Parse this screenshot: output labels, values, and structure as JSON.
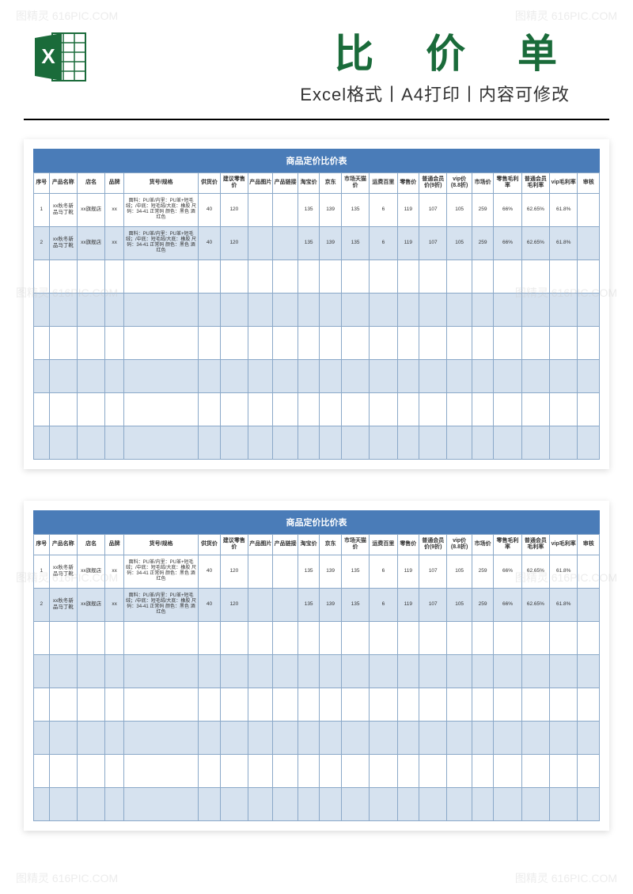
{
  "header": {
    "title": "比 价 单",
    "subtitle": "Excel格式丨A4打印丨内容可修改"
  },
  "watermarks": [
    "图精灵 616PIC.COM"
  ],
  "sheet": {
    "title": "商品定价比价表",
    "columns": [
      "序号",
      "产品名称",
      "店名",
      "品牌",
      "货号/规格",
      "供货价",
      "建议零售价",
      "产品图片",
      "产品链接",
      "淘宝价",
      "京东",
      "市场天猫价",
      "运费百里",
      "零售价",
      "普通会员价(9折)",
      "vip价(8.8折)",
      "市场价",
      "零售毛利率",
      "普通会员毛利率",
      "vip毛利率",
      "审核"
    ],
    "rows": [
      {
        "seq": "1",
        "name": "xx秋冬新品马丁靴",
        "shop": "xx旗舰店",
        "brand": "xx",
        "spec": "面料：PU革/内里：PU革+短毛绒；/中底：短毛绒/大底：橡胶 尺码：34-41 正常码 颜色：黑色 酒红色",
        "supply": "40",
        "suggest": "120",
        "img": "",
        "link": "",
        "taobao": "135",
        "jd": "139",
        "tmall": "135",
        "ship": "6",
        "retail": "119",
        "member": "107",
        "vip": "105",
        "market": "259",
        "retailrate": "66%",
        "memberrate": "62.65%",
        "viprate": "61.8%",
        "audit": ""
      },
      {
        "seq": "2",
        "name": "xx秋冬新品马丁靴",
        "shop": "xx旗舰店",
        "brand": "xx",
        "spec": "面料：PU革/内里：PU革+短毛绒；/中底：短毛绒/大底：橡胶 尺码：34-41 正常码 颜色：黑色 酒红色",
        "supply": "40",
        "suggest": "120",
        "img": "",
        "link": "",
        "taobao": "135",
        "jd": "139",
        "tmall": "135",
        "ship": "6",
        "retail": "119",
        "member": "107",
        "vip": "105",
        "market": "259",
        "retailrate": "66%",
        "memberrate": "62.65%",
        "viprate": "61.8%",
        "audit": ""
      }
    ],
    "empty_rows": 6
  },
  "chart_data": {
    "type": "table",
    "title": "商品定价比价表",
    "columns": [
      "序号",
      "产品名称",
      "店名",
      "品牌",
      "货号/规格",
      "供货价",
      "建议零售价",
      "淘宝价",
      "京东",
      "市场天猫价",
      "运费百里",
      "零售价",
      "普通会员价(9折)",
      "vip价(8.8折)",
      "市场价",
      "零售毛利率",
      "普通会员毛利率",
      "vip毛利率"
    ],
    "rows": [
      [
        1,
        "xx秋冬新品马丁靴",
        "xx旗舰店",
        "xx",
        "面料：PU革/内里：PU革+短毛绒；/中底：短毛绒/大底：橡胶 尺码：34-41 正常码 颜色：黑色 酒红色",
        40,
        120,
        135,
        139,
        135,
        6,
        119,
        107,
        105,
        259,
        "66%",
        "62.65%",
        "61.8%"
      ],
      [
        2,
        "xx秋冬新品马丁靴",
        "xx旗舰店",
        "xx",
        "面料：PU革/内里：PU革+短毛绒；/中底：短毛绒/大底：橡胶 尺码：34-41 正常码 颜色：黑色 酒红色",
        40,
        120,
        135,
        139,
        135,
        6,
        119,
        107,
        105,
        259,
        "66%",
        "62.65%",
        "61.8%"
      ]
    ]
  }
}
